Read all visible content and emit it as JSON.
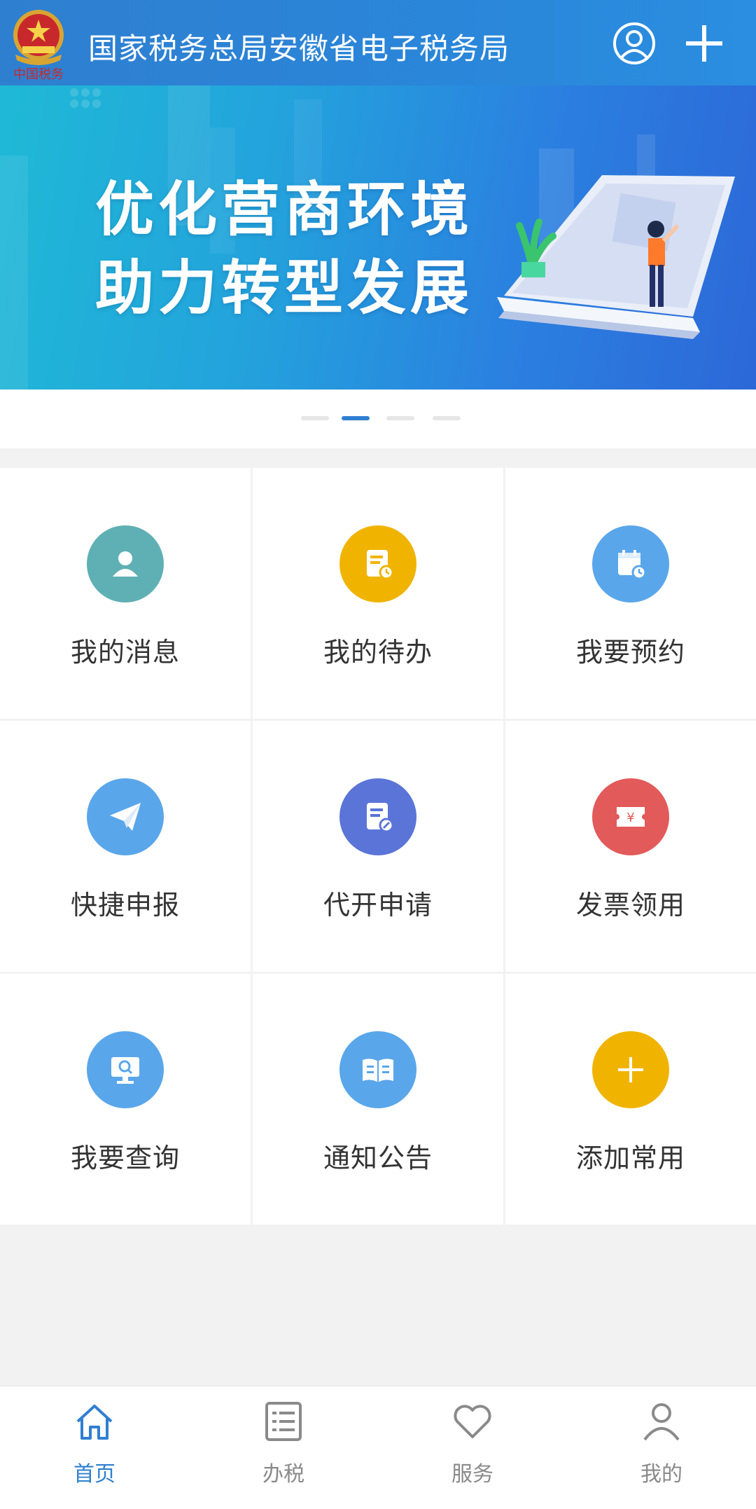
{
  "header": {
    "title": "国家税务总局安徽省电子税务局",
    "emblem_icon": "tax-emblem-icon",
    "user_icon": "user-circle-icon",
    "add_icon": "plus-icon"
  },
  "banner": {
    "line1": "优化营商环境",
    "line2": "助力转型发展",
    "active_slide": 2,
    "slide_count": 4
  },
  "grid": {
    "items": [
      {
        "label": "我的消息",
        "icon": "person-icon",
        "color": "#5fb0b4"
      },
      {
        "label": "我的待办",
        "icon": "todo-clock-icon",
        "color": "#f0b400"
      },
      {
        "label": "我要预约",
        "icon": "calendar-icon",
        "color": "#5aa6ea"
      },
      {
        "label": "快捷申报",
        "icon": "paper-plane-icon",
        "color": "#5aa6ea"
      },
      {
        "label": "代开申请",
        "icon": "document-edit-icon",
        "color": "#5b74d8"
      },
      {
        "label": "发票领用",
        "icon": "invoice-yen-icon",
        "color": "#e25a5a"
      },
      {
        "label": "我要查询",
        "icon": "monitor-search-icon",
        "color": "#5aa6ea"
      },
      {
        "label": "通知公告",
        "icon": "open-book-icon",
        "color": "#5aa6ea"
      },
      {
        "label": "添加常用",
        "icon": "plus-icon",
        "color": "#f0b400"
      }
    ]
  },
  "bottom_nav": {
    "items": [
      {
        "label": "首页",
        "icon": "home-icon",
        "active": true
      },
      {
        "label": "办税",
        "icon": "list-icon",
        "active": false
      },
      {
        "label": "服务",
        "icon": "heart-icon",
        "active": false
      },
      {
        "label": "我的",
        "icon": "user-icon",
        "active": false
      }
    ]
  },
  "colors": {
    "header_bg": "#2f7fd0",
    "accent": "#2f7fd0",
    "inactive_nav": "#8a8a8a"
  }
}
